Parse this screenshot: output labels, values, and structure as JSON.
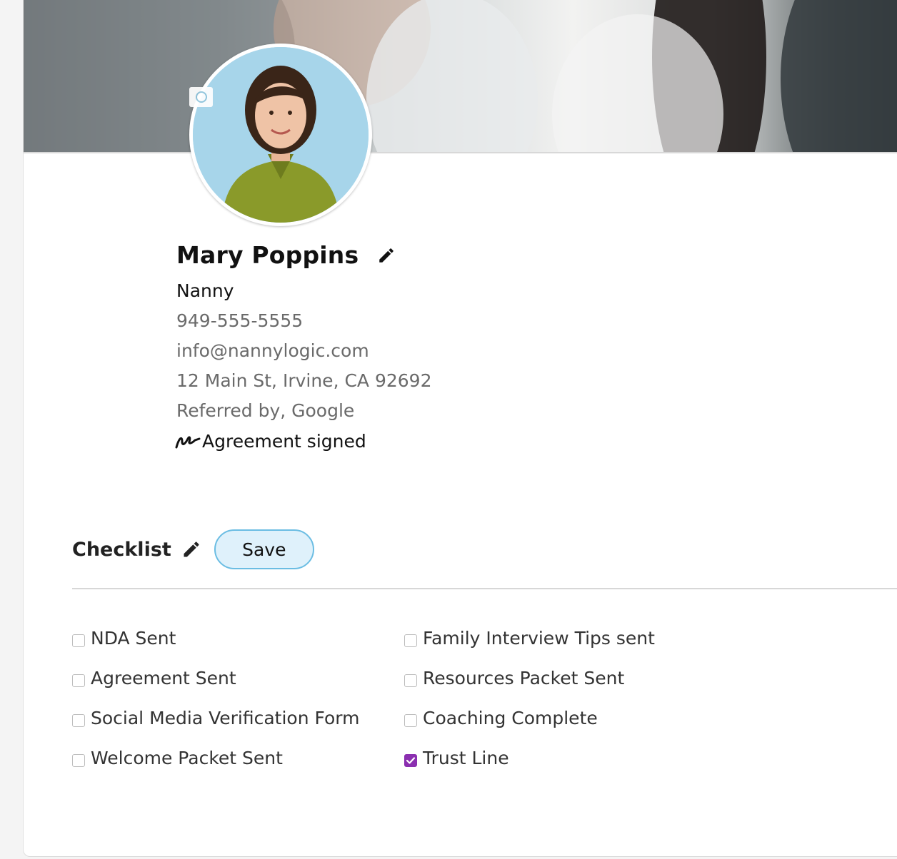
{
  "profile": {
    "name": "Mary Poppins",
    "role": "Nanny",
    "phone": "949-555-5555",
    "email": "info@nannylogic.com",
    "address": "12 Main St, Irvine, CA 92692",
    "referral": "Referred by, Google",
    "agreement_status": "Agreement signed"
  },
  "icons": {
    "name_edit": "pencil-icon",
    "camera": "camera-icon",
    "agreement": "signature-icon",
    "checklist_edit": "pencil-icon"
  },
  "checklist": {
    "title": "Checklist",
    "save_label": "Save",
    "left_items": [
      {
        "label": "NDA Sent",
        "checked": false
      },
      {
        "label": "Agreement Sent",
        "checked": false
      },
      {
        "label": "Social Media Verification Form",
        "checked": false
      },
      {
        "label": "Welcome Packet Sent",
        "checked": false
      }
    ],
    "right_items": [
      {
        "label": "Family Interview Tips sent",
        "checked": false
      },
      {
        "label": "Resources Packet Sent",
        "checked": false
      },
      {
        "label": "Coaching Complete",
        "checked": false
      },
      {
        "label": "Trust Line",
        "checked": true
      }
    ]
  },
  "colors": {
    "accent_checked": "#8b2fb0",
    "save_button_bg": "#dff1fb",
    "save_button_border": "#6bbde3"
  }
}
